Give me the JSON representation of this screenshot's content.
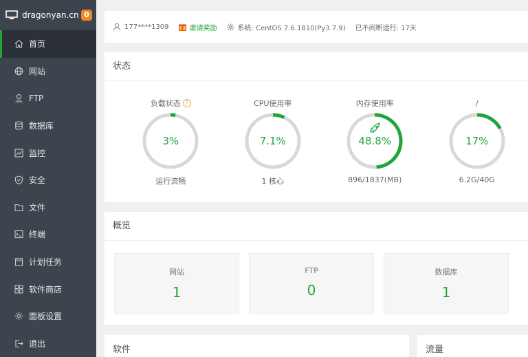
{
  "brand": {
    "name": "dragonyan.cn",
    "badge": "0"
  },
  "sidebar": {
    "items": [
      {
        "label": "首页",
        "icon": "home-icon",
        "active": true
      },
      {
        "label": "网站",
        "icon": "globe-icon"
      },
      {
        "label": "FTP",
        "icon": "ftp-icon"
      },
      {
        "label": "数据库",
        "icon": "database-icon"
      },
      {
        "label": "监控",
        "icon": "monitor-chart-icon"
      },
      {
        "label": "安全",
        "icon": "shield-icon"
      },
      {
        "label": "文件",
        "icon": "folder-icon"
      },
      {
        "label": "终端",
        "icon": "terminal-icon"
      },
      {
        "label": "计划任务",
        "icon": "calendar-icon"
      },
      {
        "label": "软件商店",
        "icon": "grid-icon"
      },
      {
        "label": "面板设置",
        "icon": "gear-icon"
      },
      {
        "label": "退出",
        "icon": "logout-icon"
      }
    ]
  },
  "topbar": {
    "user": "177****1309",
    "invite": "邀请奖励",
    "system": "系统: CentOS 7.6.1810(Py3.7.9)",
    "uptime": "已不间断运行: 17天"
  },
  "status": {
    "title": "状态",
    "gauges": [
      {
        "label": "负载状态",
        "help": "?",
        "value_text": "3%",
        "percent": 3,
        "sub": "运行流畅"
      },
      {
        "label": "CPU使用率",
        "value_text": "7.1%",
        "percent": 7.1,
        "sub": "1 核心"
      },
      {
        "label": "内存使用率",
        "value_text": "48.8%",
        "percent": 48.8,
        "sub": "896/1837(MB)",
        "rocket": true
      },
      {
        "label": "/",
        "value_text": "17%",
        "percent": 17,
        "sub": "6.2G/40G"
      }
    ]
  },
  "overview": {
    "title": "概览",
    "boxes": [
      {
        "label": "网站",
        "value": "1"
      },
      {
        "label": "FTP",
        "value": "0"
      },
      {
        "label": "数据库",
        "value": "1"
      }
    ]
  },
  "software": {
    "title": "软件"
  },
  "traffic": {
    "title": "流量"
  },
  "colors": {
    "accent": "#20a53a",
    "sidebar": "#3c444d",
    "badge": "#f08a24",
    "ring_track": "#d8d8d8"
  }
}
